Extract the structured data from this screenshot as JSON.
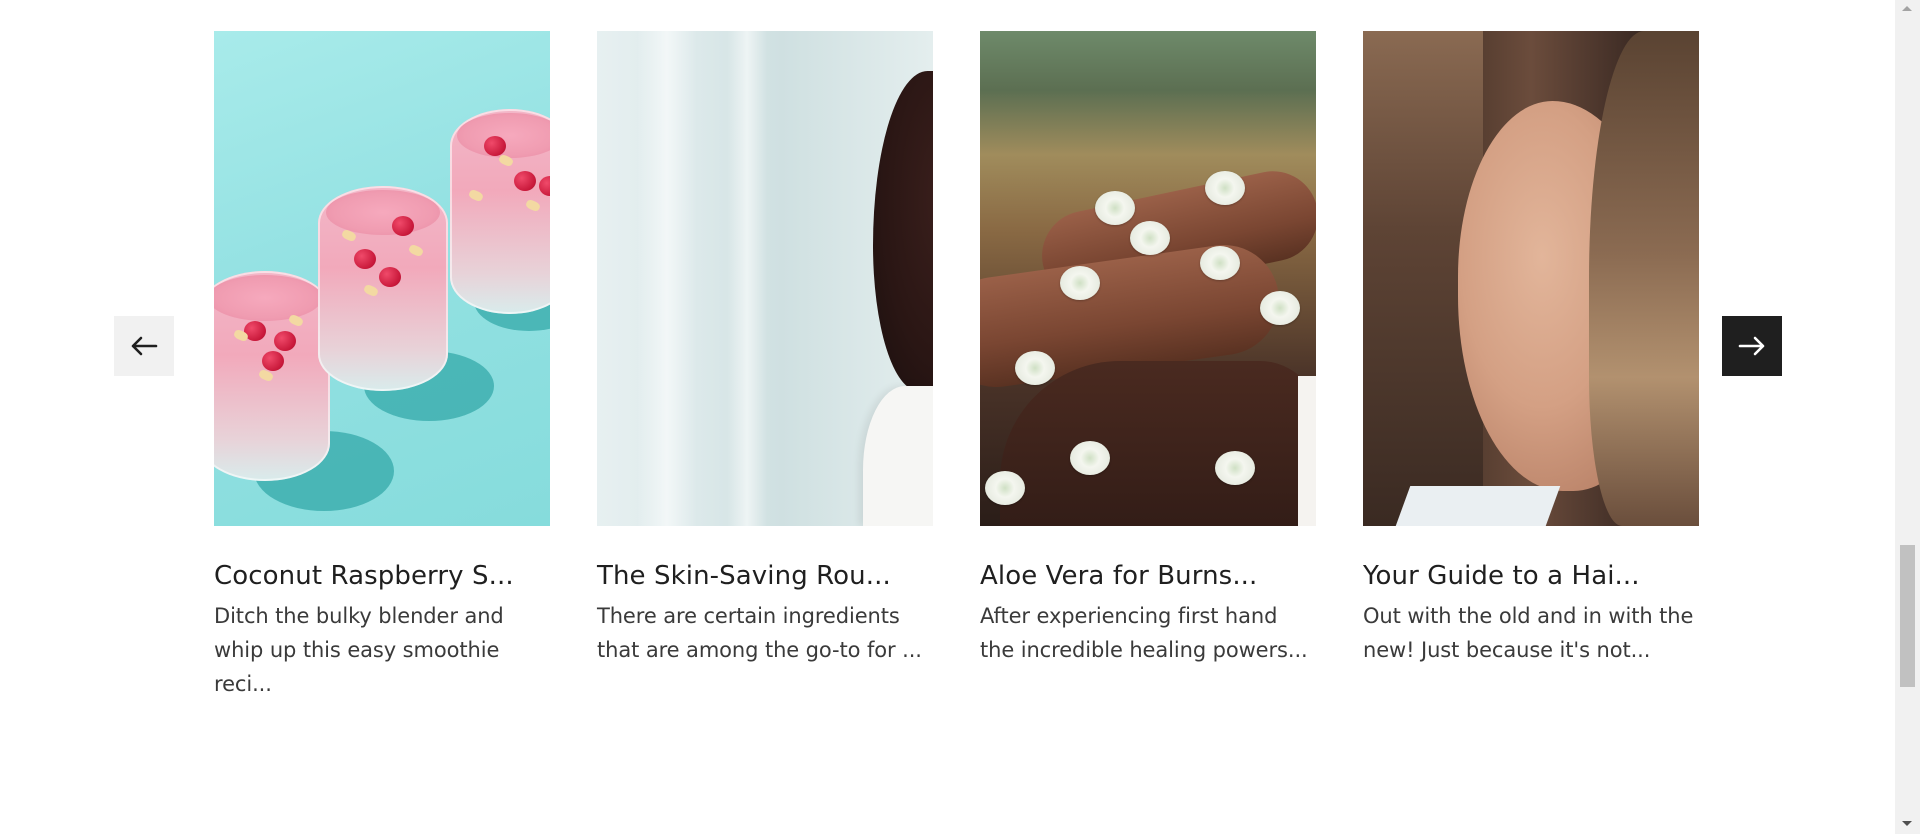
{
  "carousel": {
    "prev_label": "Previous",
    "next_label": "Next",
    "cards": [
      {
        "title": "Coconut Raspberry S...",
        "description": "Ditch the bulky blender and whip up this easy smoothie reci...",
        "image": "smoothie-glasses-image"
      },
      {
        "title": "The Skin-Saving Rou...",
        "description": "There are certain ingredients that are among the go-to for ...",
        "image": "woman-profile-image"
      },
      {
        "title": "Aloe Vera for Burns...",
        "description": "After experiencing first hand the incredible healing powers...",
        "image": "arms-with-flowers-image"
      },
      {
        "title": "Your Guide to a Hai...",
        "description": "Out with the old and in with the new! Just because it's not...",
        "image": "woman-portrait-image"
      }
    ]
  },
  "colors": {
    "prev_button_bg": "#f1f1f1",
    "next_button_bg": "#1f1f1f",
    "text": "#1f1f1f"
  },
  "icons": {
    "prev": "arrow-left-icon",
    "next": "arrow-right-icon"
  }
}
